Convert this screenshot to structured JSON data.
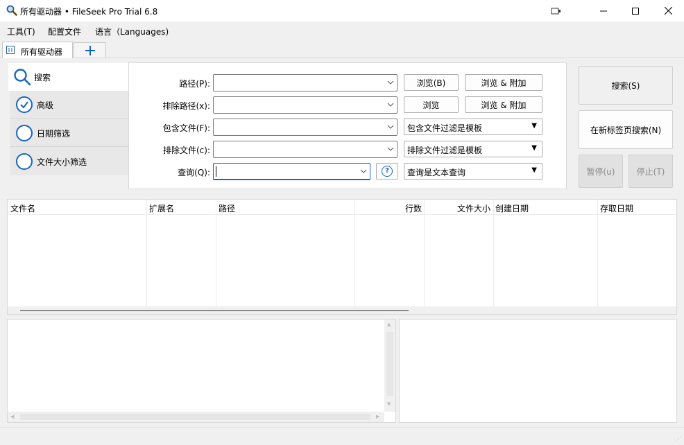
{
  "window": {
    "title": "所有驱动器 • FileSeek Pro Trial 6.8",
    "controls": {
      "minimize": "minimize",
      "maximize": "maximize",
      "close": "close"
    }
  },
  "menu": [
    {
      "label": "工具(T)"
    },
    {
      "label": "配置文件"
    },
    {
      "label": "语言（Languages)"
    }
  ],
  "tabs": {
    "active_label": "所有驱动器",
    "add_label": "+"
  },
  "nav": {
    "search_label": "搜索",
    "items": [
      {
        "label": "高级",
        "checked": true
      },
      {
        "label": "日期筛选",
        "checked": false
      },
      {
        "label": "文件大小筛选",
        "checked": false
      }
    ]
  },
  "form": {
    "path_label": "路径(P):",
    "exclude_path_label": "排除路径(x):",
    "include_files_label": "包含文件(F):",
    "exclude_files_label": "排除文件(c):",
    "query_label": "查询(Q):",
    "path_value": "",
    "exclude_path_value": "",
    "include_files_value": "",
    "exclude_files_value": "",
    "query_value": "",
    "browse_b": "浏览(B)",
    "browse_add_1": "浏览 & 附加",
    "browse": "浏览",
    "browse_add_2": "浏览 & 附加",
    "include_filter_mode": "包含文件过滤是模板",
    "exclude_filter_mode": "排除文件过滤是模板",
    "query_mode": "查询是文本查询",
    "help_icon": "?"
  },
  "actions": {
    "search": "搜索(S)",
    "search_new_tab": "在新标签页搜索(N)",
    "pause": "暂停(u)",
    "stop": "停止(T)"
  },
  "table": {
    "columns": [
      "文件名",
      "扩展名",
      "路径",
      "行数",
      "文件大小",
      "创建日期",
      "存取日期"
    ],
    "rows": []
  },
  "colors": {
    "accent": "#1565c0",
    "window_bg": "#f0f0f0",
    "panel_bg": "#ffffff",
    "disabled_text": "#8a8a8a"
  }
}
